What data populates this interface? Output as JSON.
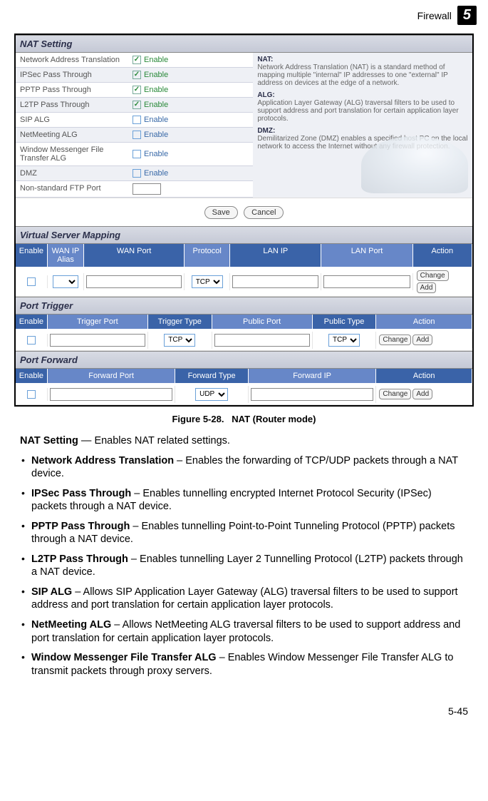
{
  "header": {
    "section": "Firewall",
    "chapter_badge": "5"
  },
  "screenshot": {
    "nat_setting": {
      "title": "NAT Setting",
      "rows": [
        {
          "label": "Network Address Translation",
          "enable": "Enable",
          "checked": true
        },
        {
          "label": "IPSec Pass Through",
          "enable": "Enable",
          "checked": true
        },
        {
          "label": "PPTP Pass Through",
          "enable": "Enable",
          "checked": true
        },
        {
          "label": "L2TP Pass Through",
          "enable": "Enable",
          "checked": true
        },
        {
          "label": "SIP ALG",
          "enable": "Enable",
          "checked": false
        },
        {
          "label": "NetMeeting ALG",
          "enable": "Enable",
          "checked": false
        },
        {
          "label": "Window Messenger File Transfer ALG",
          "enable": "Enable",
          "checked": false
        },
        {
          "label": "DMZ",
          "enable": "Enable",
          "checked": false
        },
        {
          "label": "Non-standard FTP Port",
          "enable": "",
          "checked": null
        }
      ],
      "help": {
        "nat_term": "NAT:",
        "nat_text": "Network Address Translation (NAT) is a standard method of mapping multiple \"internal\" IP addresses to one \"external\" IP address on devices at the edge of a network.",
        "alg_term": "ALG:",
        "alg_text": "Application Layer Gateway (ALG) traversal filters to be used to support address and port translation for certain application layer protocols.",
        "dmz_term": "DMZ:",
        "dmz_text": "Demilitarized Zone (DMZ) enables a specified host PC on the local network to access the Internet without any firewall protection."
      },
      "buttons": {
        "save": "Save",
        "cancel": "Cancel"
      }
    },
    "vsm": {
      "title": "Virtual Server Mapping",
      "cols": {
        "enable": "Enable",
        "wan_ip_alias": "WAN IP Alias",
        "wan_port": "WAN Port",
        "protocol": "Protocol",
        "lan_ip": "LAN IP",
        "lan_port": "LAN Port",
        "action": "Action"
      },
      "proto_val": "TCP",
      "btn_change": "Change",
      "btn_add": "Add"
    },
    "pt": {
      "title": "Port Trigger",
      "cols": {
        "enable": "Enable",
        "trigger_port": "Trigger Port",
        "trigger_type": "Trigger Type",
        "public_port": "Public Port",
        "public_type": "Public Type",
        "action": "Action"
      },
      "ttype_val": "TCP",
      "ptype_val": "TCP",
      "btn_change": "Change",
      "btn_add": "Add"
    },
    "pf": {
      "title": "Port Forward",
      "cols": {
        "enable": "Enable",
        "forward_port": "Forward Port",
        "forward_type": "Forward Type",
        "forward_ip": "Forward IP",
        "action": "Action"
      },
      "ftype_val": "UDP",
      "btn_change": "Change",
      "btn_add": "Add"
    }
  },
  "caption": {
    "figure": "Figure 5-28.",
    "title": "NAT (Router mode)"
  },
  "prose": {
    "intro_term": "NAT Setting",
    "intro_rest": " — Enables NAT related settings.",
    "items": [
      {
        "term": "Network Address Translation",
        "rest": " – Enables the forwarding of TCP/UDP packets through a NAT device."
      },
      {
        "term": "IPSec Pass Through",
        "rest": " – Enables tunnelling encrypted Internet Protocol Security (IPSec) packets through a NAT device."
      },
      {
        "term": "PPTP Pass Through",
        "rest": " – Enables tunnelling Point-to-Point Tunneling Protocol (PPTP) packets through a NAT device."
      },
      {
        "term": "L2TP Pass Through",
        "rest": " – Enables tunnelling Layer 2 Tunnelling Protocol (L2TP) packets through a NAT device."
      },
      {
        "term": "SIP ALG",
        "rest": " – Allows SIP Application Layer Gateway (ALG) traversal filters to be used to support address and port translation for certain application layer protocols."
      },
      {
        "term": "NetMeeting ALG",
        "rest": " – Allows NetMeeting ALG traversal filters to be used to support address and port translation for certain application layer protocols."
      },
      {
        "term": "Window Messenger File Transfer ALG",
        "rest": " – Enables Window Messenger File Transfer ALG to transmit packets through proxy servers."
      }
    ]
  },
  "footer": {
    "pageno": "5-45"
  }
}
